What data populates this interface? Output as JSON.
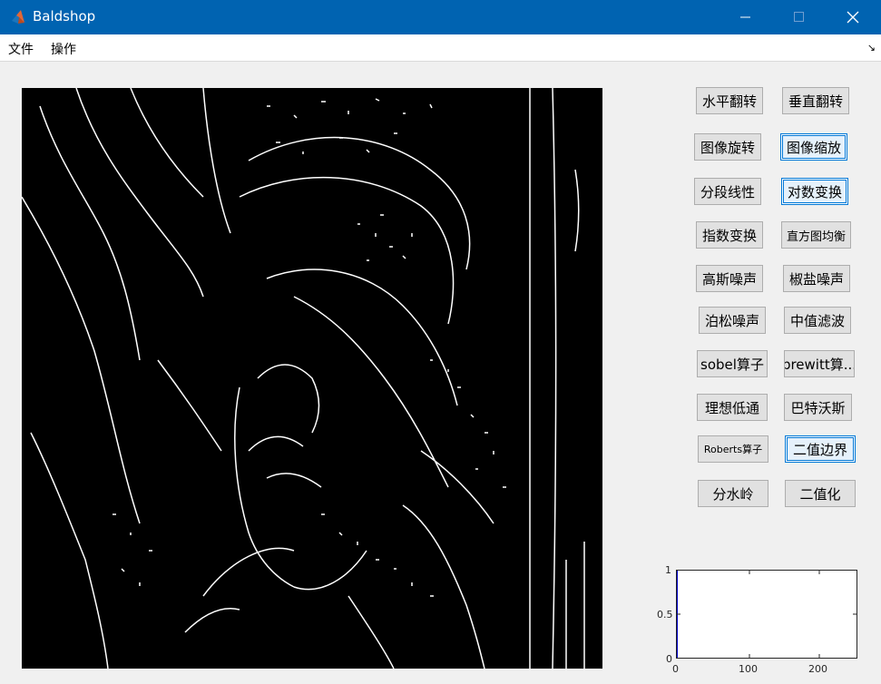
{
  "window": {
    "title": "Baldshop"
  },
  "menu": {
    "items": [
      "文件",
      "操作"
    ]
  },
  "buttons": [
    {
      "label": "水平翻转"
    },
    {
      "label": "垂直翻转"
    },
    {
      "label": "图像旋转"
    },
    {
      "label": "图像缩放"
    },
    {
      "label": "分段线性"
    },
    {
      "label": "对数变换"
    },
    {
      "label": "指数变换"
    },
    {
      "label": "直方图均衡"
    },
    {
      "label": "高斯噪声"
    },
    {
      "label": "椒盐噪声"
    },
    {
      "label": "泊松噪声"
    },
    {
      "label": "中值滤波"
    },
    {
      "label": "sobel算子"
    },
    {
      "label": "prewitt算..."
    },
    {
      "label": "理想低通"
    },
    {
      "label": "巴特沃斯"
    },
    {
      "label": "Roberts算子"
    },
    {
      "label": "二值边界"
    },
    {
      "label": "分水岭"
    },
    {
      "label": "二值化"
    }
  ],
  "histogram": {
    "yticks": [
      "1",
      "0.5",
      "0"
    ],
    "xticks": [
      "0",
      "100",
      "200"
    ]
  },
  "colors": {
    "titlebar": "#0063b1",
    "focus": "#0078d7",
    "edge_image_bg": "#000000"
  }
}
